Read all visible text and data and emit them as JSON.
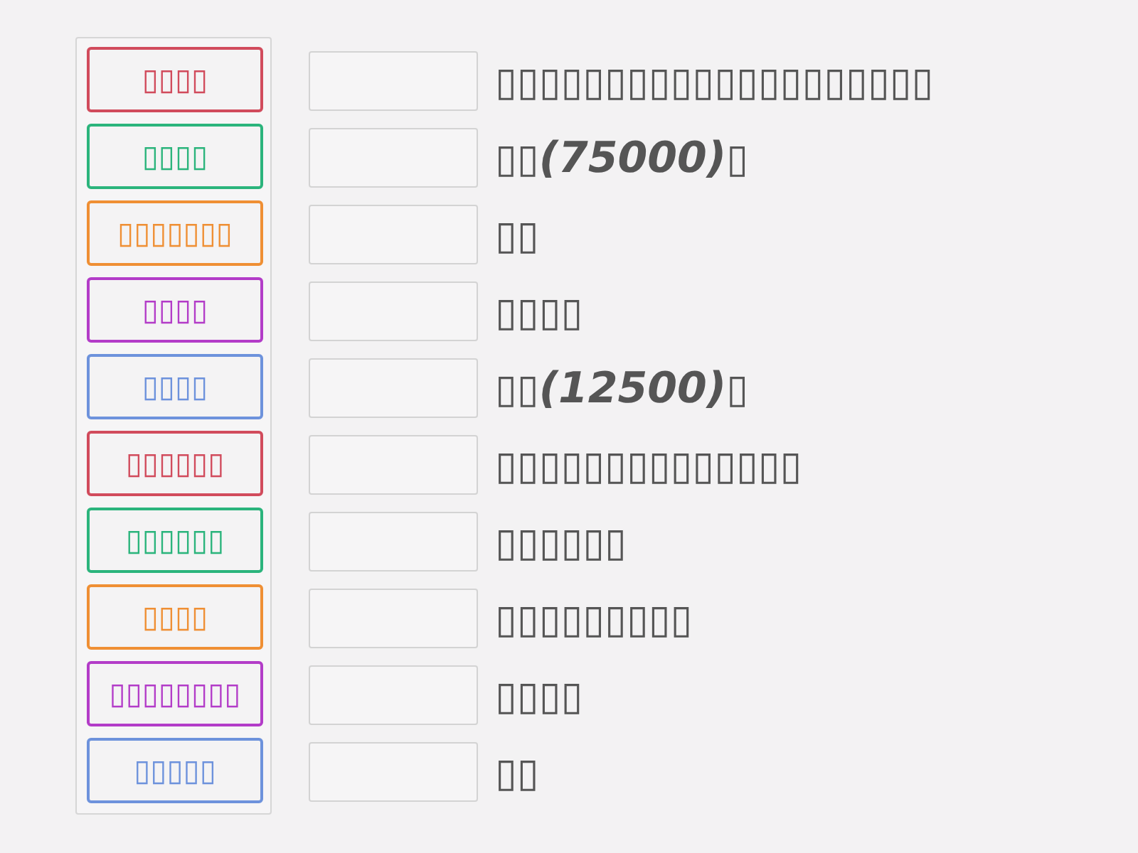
{
  "tiles": [
    {
      "text": "▯▯▯▯",
      "color": "#d14b5c"
    },
    {
      "text": "▯▯▯▯",
      "color": "#2bb47c"
    },
    {
      "text": "▯▯▯▯▯▯▯",
      "color": "#ef8f34"
    },
    {
      "text": "▯▯▯▯",
      "color": "#b33cc8"
    },
    {
      "text": "▯▯▯▯",
      "color": "#6d92dc"
    },
    {
      "text": "▯▯▯▯▯▯",
      "color": "#d14b5c"
    },
    {
      "text": "▯▯▯▯▯▯",
      "color": "#2bb47c"
    },
    {
      "text": "▯▯▯▯",
      "color": "#ef8f34"
    },
    {
      "text": "▯▯▯▯▯▯▯▯",
      "color": "#b33cc8"
    },
    {
      "text": "▯▯▯▯▯",
      "color": "#6d92dc"
    }
  ],
  "rows": [
    {
      "text": "▯▯▯▯▯▯▯▯▯▯▯▯▯▯▯▯▯▯▯▯"
    },
    {
      "text": "▯▯*(75000)*▯"
    },
    {
      "text": "▯▯"
    },
    {
      "text": "▯▯▯▯"
    },
    {
      "text": "▯▯*(12500)*▯"
    },
    {
      "text": "▯▯▯▯▯▯▯▯▯▯▯▯▯▯"
    },
    {
      "text": "▯▯▯▯▯▯"
    },
    {
      "text": "▯▯▯▯▯▯▯▯▯"
    },
    {
      "text": "▯▯▯▯"
    },
    {
      "text": "▯▯"
    }
  ]
}
